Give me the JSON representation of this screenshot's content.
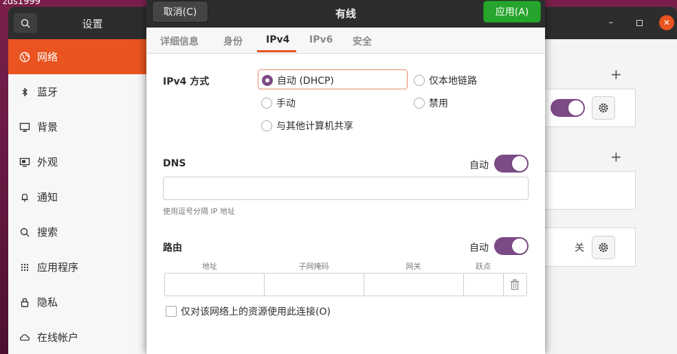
{
  "desktop": {
    "label": "zds1999"
  },
  "settings": {
    "title": "设置",
    "sidebar": [
      {
        "label": "网络",
        "icon": "globe-icon",
        "active": true
      },
      {
        "label": "蓝牙",
        "icon": "bluetooth-icon"
      },
      {
        "label": "背景",
        "icon": "monitor-icon"
      },
      {
        "label": "外观",
        "icon": "appearance-icon"
      },
      {
        "label": "通知",
        "icon": "bell-icon"
      },
      {
        "label": "搜索",
        "icon": "search-icon"
      },
      {
        "label": "应用程序",
        "icon": "grid-icon"
      },
      {
        "label": "隐私",
        "icon": "lock-icon"
      },
      {
        "label": "在线帐户",
        "icon": "cloud-icon"
      }
    ],
    "bg_vpn_off_label": "关"
  },
  "dialog": {
    "title": "有线",
    "cancel_label": "取消(C)",
    "apply_label": "应用(A)",
    "tabs": [
      "详细信息",
      "身份",
      "IPv4",
      "IPv6",
      "安全"
    ],
    "active_tab": "IPv4",
    "ipv4_method_label": "IPv4 方式",
    "methods": {
      "auto_dhcp": "自动 (DHCP)",
      "link_local": "仅本地链路",
      "manual": "手动",
      "disabled": "禁用",
      "shared": "与其他计算机共享"
    },
    "selected_method": "auto_dhcp",
    "dns": {
      "label": "DNS",
      "auto_label": "自动",
      "auto": true,
      "value": "",
      "hint": "使用逗号分隔 IP 地址"
    },
    "routes": {
      "label": "路由",
      "auto_label": "自动",
      "auto": true,
      "columns": [
        "地址",
        "子网掩码",
        "网关",
        "跃点"
      ]
    },
    "only_local_resources_label": "仅对该网络上的资源使用此连接(O)"
  },
  "colors": {
    "accent": "#e95420",
    "apply_green": "#26a52c",
    "toggle_purple": "#7c4a85"
  }
}
